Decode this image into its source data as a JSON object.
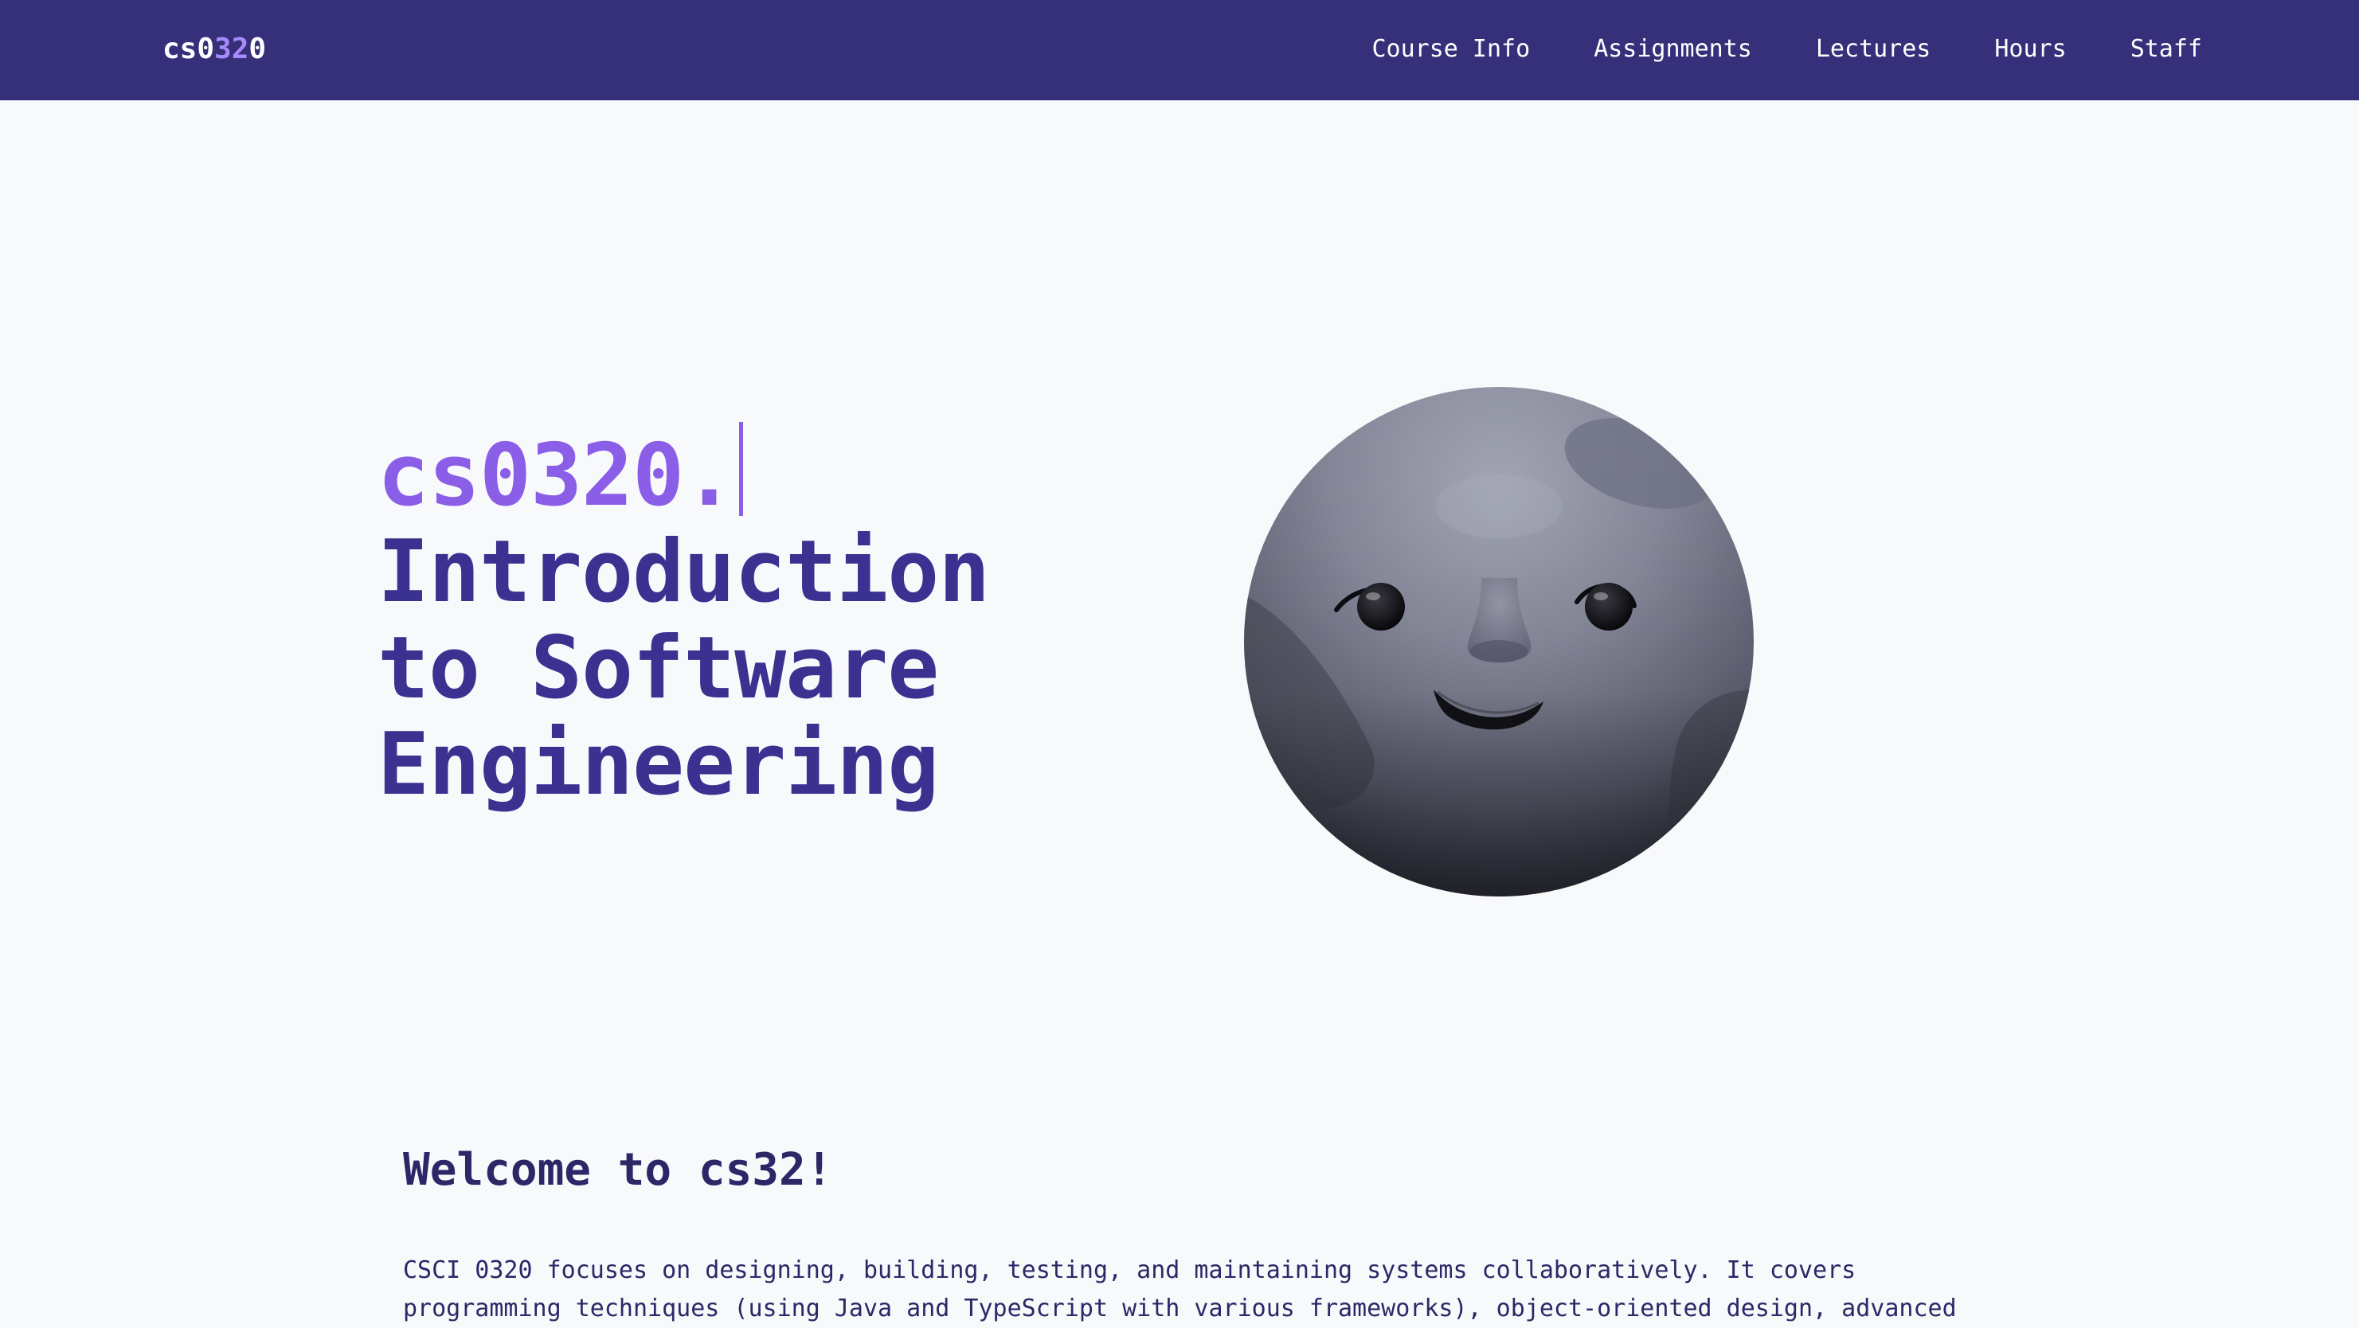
{
  "nav": {
    "brand_prefix": "cs0",
    "brand_highlight": "32",
    "brand_suffix": "0",
    "links": [
      "Course Info",
      "Assignments",
      "Lectures",
      "Hours",
      "Staff"
    ]
  },
  "hero": {
    "code": "cs0320.",
    "title_lines": [
      "Introduction",
      "to Software",
      "Engineering"
    ],
    "image_icon": "moon-face-icon"
  },
  "welcome": {
    "heading": "Welcome to cs32!",
    "paragraph_lines": [
      "CSCI 0320 focuses on designing, building, testing, and maintaining systems collaboratively. It covers",
      "programming techniques (using Java and TypeScript with various frameworks), object-oriented design, advanced"
    ]
  },
  "colors": {
    "navbar": "#36307b",
    "accent_purple": "#8b5ee8",
    "title_indigo": "#3a3190",
    "text_dark": "#2c2868",
    "background": "#f8f9fb"
  }
}
